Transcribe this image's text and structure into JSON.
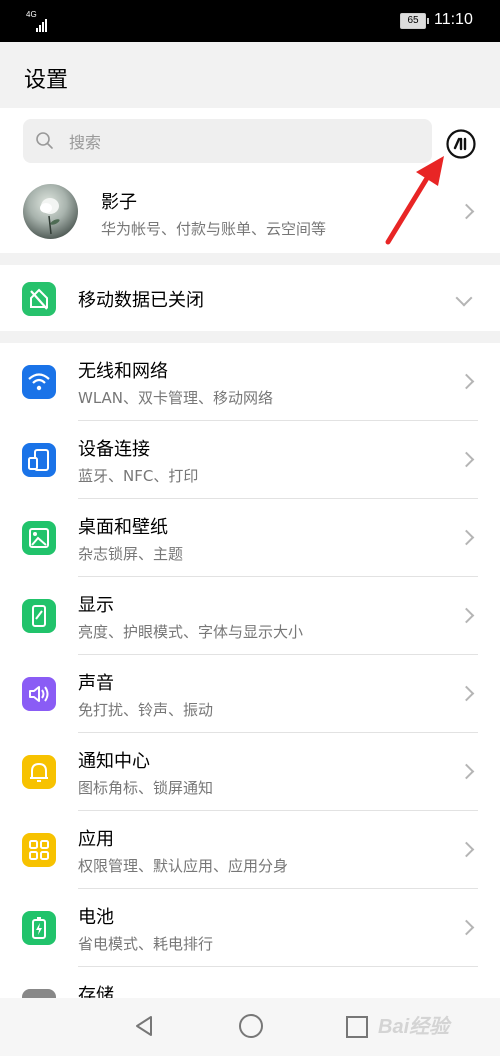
{
  "status_bar": {
    "network": "4G",
    "battery": "65",
    "time": "11:10"
  },
  "header": {
    "title": "设置"
  },
  "search": {
    "placeholder": "搜索"
  },
  "profile": {
    "name": "影子",
    "subtitle": "华为帐号、付款与账单、云空间等"
  },
  "mobile_data": {
    "label": "移动数据已关闭"
  },
  "settings": [
    {
      "title": "无线和网络",
      "subtitle": "WLAN、双卡管理、移动网络",
      "icon": "wifi-icon",
      "color": "#1a73e8"
    },
    {
      "title": "设备连接",
      "subtitle": "蓝牙、NFC、打印",
      "icon": "device-connection-icon",
      "color": "#1a73e8"
    },
    {
      "title": "桌面和壁纸",
      "subtitle": "杂志锁屏、主题",
      "icon": "wallpaper-icon",
      "color": "#21c36b"
    },
    {
      "title": "显示",
      "subtitle": "亮度、护眼模式、字体与显示大小",
      "icon": "display-icon",
      "color": "#21c36b"
    },
    {
      "title": "声音",
      "subtitle": "免打扰、铃声、振动",
      "icon": "sound-icon",
      "color": "#8a5cf5"
    },
    {
      "title": "通知中心",
      "subtitle": "图标角标、锁屏通知",
      "icon": "bell-icon",
      "color": "#f7c200"
    },
    {
      "title": "应用",
      "subtitle": "权限管理、默认应用、应用分身",
      "icon": "apps-icon",
      "color": "#f7c200"
    },
    {
      "title": "电池",
      "subtitle": "省电模式、耗电排行",
      "icon": "battery-icon",
      "color": "#21c36b"
    },
    {
      "title": "存储",
      "subtitle": "",
      "icon": "storage-icon",
      "color": "#888888"
    }
  ],
  "watermark": "Bai经验",
  "colors": {
    "arrow": "#e82525",
    "accent": "#1a73e8"
  }
}
